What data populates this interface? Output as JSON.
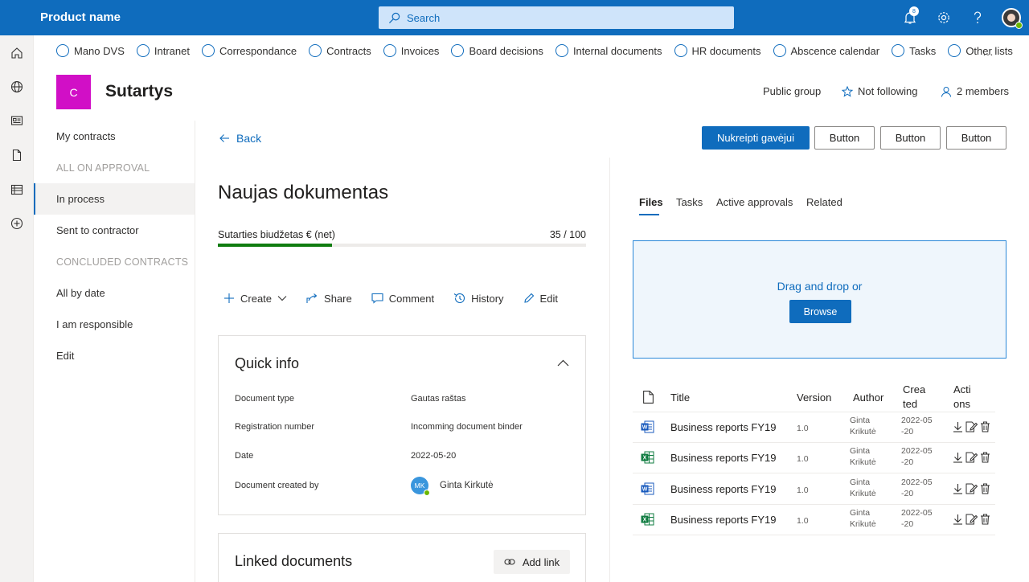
{
  "topbar": {
    "product_name": "Product name",
    "search_placeholder": "Search",
    "notification_count": "8",
    "brand_color": "#0f6cbd"
  },
  "hub_nav": {
    "items": [
      "Mano DVS",
      "Intranet",
      "Correspondance",
      "Contracts",
      "Invoices",
      "Board decisions",
      "Internal documents",
      "HR documents",
      "Abscence calendar",
      "Tasks",
      "Other lists"
    ],
    "more": "…"
  },
  "site": {
    "logo_letter": "C",
    "logo_color": "#d10fc6",
    "title": "Sutartys",
    "privacy": "Public group",
    "follow": "Not following",
    "members": "2 members"
  },
  "leftnav": {
    "my_contracts": "My contracts",
    "all_on_approval": "ALL ON APPROVAL",
    "in_process": "In process",
    "sent_to_contractor": "Sent to contractor",
    "concluded_contracts": "CONCLUDED CONTRACTS",
    "all_by_date": "All by date",
    "i_am_responsible": "I am responsible",
    "edit": "Edit"
  },
  "main": {
    "back": "Back",
    "doc_title": "Naujas dokumentas",
    "budget_label": "Sutarties biudžetas € (net)",
    "budget_value": "35 / 100",
    "budget_fraction": 0.31,
    "commands": {
      "create": "Create",
      "share": "Share",
      "comment": "Comment",
      "history": "History",
      "edit": "Edit"
    },
    "quick_info": {
      "title": "Quick info",
      "rows": [
        {
          "label": "Document type",
          "value": "Gautas raštas"
        },
        {
          "label": "Registration number",
          "value": "Incomming document binder"
        },
        {
          "label": "Date",
          "value": "2022-05-20"
        },
        {
          "label": "Document created by",
          "value": "Ginta Kirkutė",
          "initials": "MK"
        }
      ]
    },
    "linked": {
      "title": "Linked documents",
      "add_link": "Add link"
    }
  },
  "actions_bar": {
    "primary": "Nukreipti gavėjui",
    "button1": "Button",
    "button2": "Button",
    "button3": "Button"
  },
  "tabs": {
    "files": "Files",
    "tasks": "Tasks",
    "active_approvals": "Active approvals",
    "related": "Related"
  },
  "dropzone": {
    "text": "Drag and drop or",
    "browse": "Browse"
  },
  "files_table": {
    "headers": {
      "title": "Title",
      "version": "Version",
      "author": "Author",
      "created_1": "Crea",
      "created_2": "ted",
      "actions_1": "Acti",
      "actions_2": "ons"
    },
    "rows": [
      {
        "type": "word-icon",
        "title": "Business reports FY19",
        "version": "1.0",
        "author_1": "Ginta",
        "author_2": "Krikutė",
        "created_1": "2022-05",
        "created_2": "-20"
      },
      {
        "type": "excel-icon",
        "title": "Business reports FY19",
        "version": "1.0",
        "author_1": "Ginta",
        "author_2": "Krikutė",
        "created_1": "2022-05",
        "created_2": "-20"
      },
      {
        "type": "word-icon",
        "title": "Business reports FY19",
        "version": "1.0",
        "author_1": "Ginta",
        "author_2": "Krikutė",
        "created_1": "2022-05",
        "created_2": "-20"
      },
      {
        "type": "excel-icon",
        "title": "Business reports FY19",
        "version": "1.0",
        "author_1": "Ginta",
        "author_2": "Krikutė",
        "created_1": "2022-05",
        "created_2": "-20"
      }
    ]
  }
}
